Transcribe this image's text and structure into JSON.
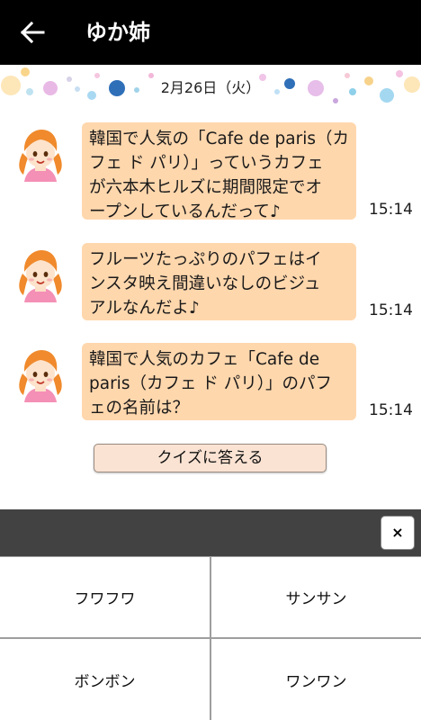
{
  "header": {
    "title": "ゆか姉",
    "back_icon": "arrow-left-icon"
  },
  "date": "2月26日（火）",
  "messages": [
    {
      "lines": [
        "韓国で人気の「Cafe de paris（カ",
        "フェ ド パリ）」っていうカフェ",
        "が六本木ヒルズに期間限定でオ",
        "ープンしているんだって♪"
      ],
      "time": "15:14"
    },
    {
      "lines": [
        "フルーツたっぷりのパフェはイ",
        "ンスタ映え間違いなしのビジュ",
        "アルなんだよ♪"
      ],
      "time": "15:14"
    },
    {
      "lines": [
        "韓国で人気のカフェ「Cafe de",
        "paris（カフェ ド パリ）」のパフ",
        "ェの名前は？"
      ],
      "time": "15:14"
    }
  ],
  "quiz_button": "クイズに答える",
  "close_label": "×",
  "answers": [
    "フワフワ",
    "サンサン",
    "ボンボン",
    "ワンワン"
  ],
  "colors": {
    "header_bg": "#000000",
    "bubble": "#ffd7ad",
    "quiz_button_bg": "#fae3d3",
    "panel_bar": "#424242"
  }
}
